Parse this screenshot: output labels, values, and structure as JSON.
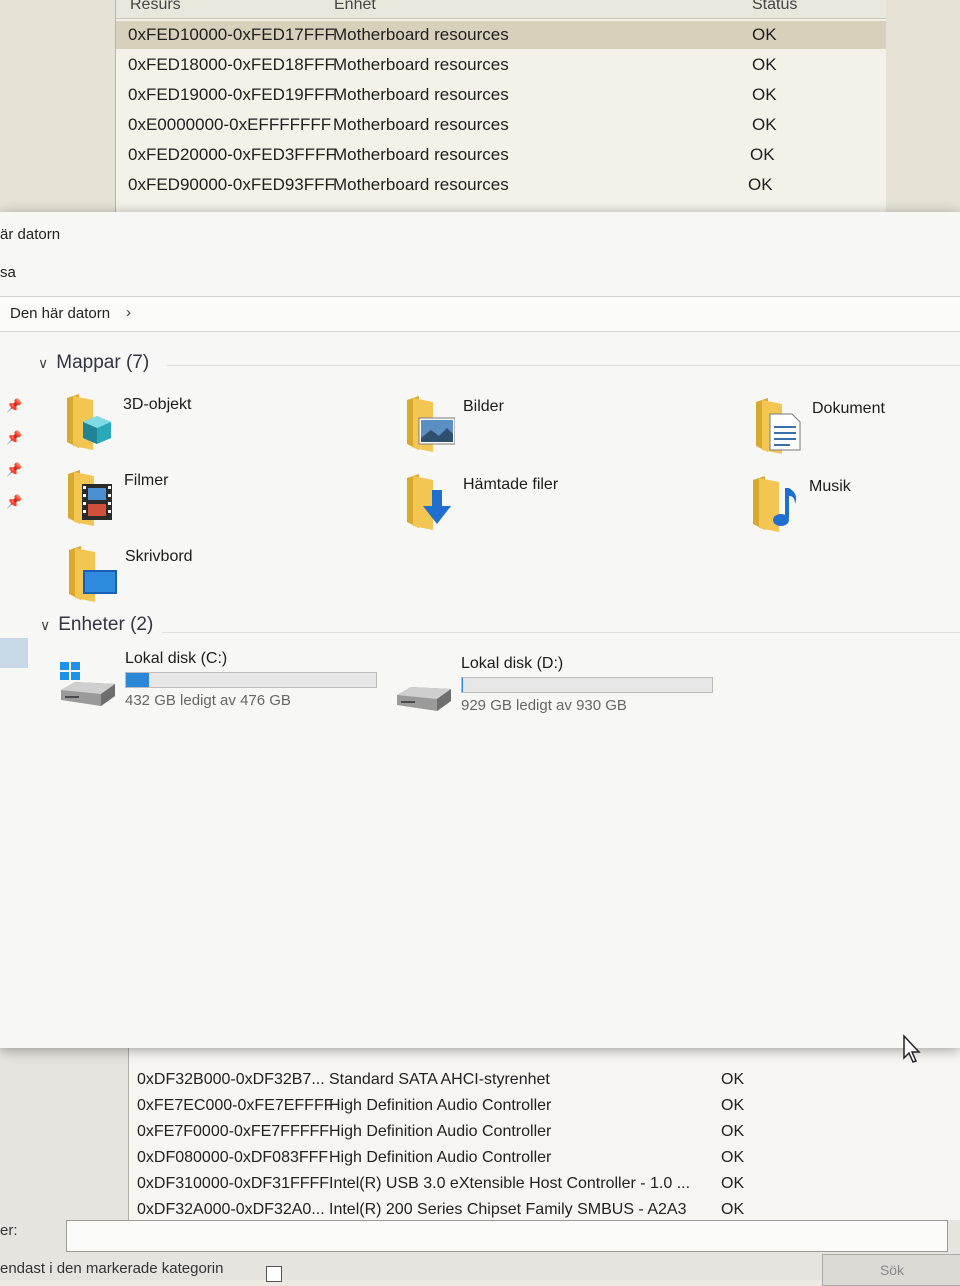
{
  "resource_window": {
    "columns": [
      "Resurs",
      "Enhet",
      "Status"
    ],
    "rows": [
      {
        "resource": "0xFED10000-0xFED17FFF",
        "device": "Motherboard resources",
        "status": "OK",
        "selected": true
      },
      {
        "resource": "0xFED18000-0xFED18FFF",
        "device": "Motherboard resources",
        "status": "OK"
      },
      {
        "resource": "0xFED19000-0xFED19FFF",
        "device": "Motherboard resources",
        "status": "OK"
      },
      {
        "resource": "0xE0000000-0xEFFFFFFF",
        "device": "Motherboard resources",
        "status": "OK"
      },
      {
        "resource": "0xFED20000-0xFED3FFFF",
        "device": "Motherboard resources",
        "status": "OK"
      },
      {
        "resource": "0xFED90000-0xFED93FFF",
        "device": "Motherboard resources",
        "status": "OK"
      }
    ]
  },
  "explorer": {
    "title": "är datorn",
    "ribbon": "sa",
    "breadcrumb": "Den här datorn",
    "folders_group": "Mappar (7)",
    "folders": [
      "3D-objekt",
      "Bilder",
      "Dokument",
      "Filmer",
      "Hämtade filer",
      "Musik",
      "Skrivbord"
    ],
    "devices_group": "Enheter (2)",
    "drives": [
      {
        "name": "Lokal disk (C:)",
        "space": "432 GB ledigt av 476 GB",
        "used_fraction": 0.092
      },
      {
        "name": "Lokal disk (D:)",
        "space": "929 GB ledigt av 930 GB",
        "used_fraction": 0.001
      }
    ]
  },
  "lower_window": {
    "rows": [
      {
        "resource": "0xDF32B000-0xDF32B7...",
        "device": "Standard SATA AHCI-styrenhet",
        "status": "OK"
      },
      {
        "resource": "0xFE7EC000-0xFE7EFFFF",
        "device": "High Definition Audio Controller",
        "status": "OK"
      },
      {
        "resource": "0xFE7F0000-0xFE7FFFFF",
        "device": "High Definition Audio Controller",
        "status": "OK"
      },
      {
        "resource": "0xDF080000-0xDF083FFF",
        "device": "High Definition Audio Controller",
        "status": "OK"
      },
      {
        "resource": "0xDF310000-0xDF31FFFF",
        "device": "Intel(R) USB 3.0 eXtensible Host Controller - 1.0 ...",
        "status": "OK"
      },
      {
        "resource": "0xDF32A000-0xDF32A0...",
        "device": "Intel(R) 200 Series Chipset Family SMBUS - A2A3",
        "status": "OK"
      }
    ],
    "search_label": "er:",
    "only_selected_label": "endast i den markerade kategorin",
    "search_button": "Sök"
  }
}
